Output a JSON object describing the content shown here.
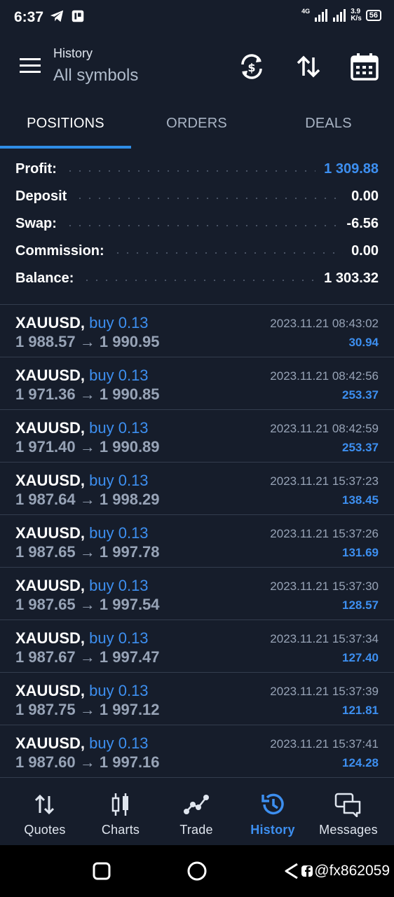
{
  "status_bar": {
    "time": "6:37",
    "network": "4G",
    "speed_top": "3.9",
    "speed_unit": "K/s",
    "battery": "56"
  },
  "header": {
    "title": "History",
    "subtitle": "All symbols"
  },
  "tabs": [
    {
      "label": "POSITIONS",
      "active": true
    },
    {
      "label": "ORDERS",
      "active": false
    },
    {
      "label": "DEALS",
      "active": false
    }
  ],
  "summary": [
    {
      "label": "Profit:",
      "value": "1 309.88",
      "accent": true
    },
    {
      "label": "Deposit",
      "value": "0.00",
      "accent": false
    },
    {
      "label": "Swap:",
      "value": "-6.56",
      "accent": false
    },
    {
      "label": "Commission:",
      "value": "0.00",
      "accent": false
    },
    {
      "label": "Balance:",
      "value": "1 303.32",
      "accent": false
    }
  ],
  "deals": [
    {
      "symbol": "XAUUSD,",
      "type": "buy 0.13",
      "open": "1 988.57",
      "close": "1 990.95",
      "time": "2023.11.21 08:43:02",
      "profit": "30.94"
    },
    {
      "symbol": "XAUUSD,",
      "type": "buy 0.13",
      "open": "1 971.36",
      "close": "1 990.85",
      "time": "2023.11.21 08:42:56",
      "profit": "253.37"
    },
    {
      "symbol": "XAUUSD,",
      "type": "buy 0.13",
      "open": "1 971.40",
      "close": "1 990.89",
      "time": "2023.11.21 08:42:59",
      "profit": "253.37"
    },
    {
      "symbol": "XAUUSD,",
      "type": "buy 0.13",
      "open": "1 987.64",
      "close": "1 998.29",
      "time": "2023.11.21 15:37:23",
      "profit": "138.45"
    },
    {
      "symbol": "XAUUSD,",
      "type": "buy 0.13",
      "open": "1 987.65",
      "close": "1 997.78",
      "time": "2023.11.21 15:37:26",
      "profit": "131.69"
    },
    {
      "symbol": "XAUUSD,",
      "type": "buy 0.13",
      "open": "1 987.65",
      "close": "1 997.54",
      "time": "2023.11.21 15:37:30",
      "profit": "128.57"
    },
    {
      "symbol": "XAUUSD,",
      "type": "buy 0.13",
      "open": "1 987.67",
      "close": "1 997.47",
      "time": "2023.11.21 15:37:34",
      "profit": "127.40"
    },
    {
      "symbol": "XAUUSD,",
      "type": "buy 0.13",
      "open": "1 987.75",
      "close": "1 997.12",
      "time": "2023.11.21 15:37:39",
      "profit": "121.81"
    },
    {
      "symbol": "XAUUSD,",
      "type": "buy 0.13",
      "open": "1 987.60",
      "close": "1 997.16",
      "time": "2023.11.21 15:37:41",
      "profit": "124.28"
    }
  ],
  "price_arrow": "→",
  "bottom_nav": [
    {
      "label": "Quotes",
      "icon": "quotes-icon",
      "active": false
    },
    {
      "label": "Charts",
      "icon": "charts-icon",
      "active": false
    },
    {
      "label": "Trade",
      "icon": "trade-icon",
      "active": false
    },
    {
      "label": "History",
      "icon": "history-icon",
      "active": true
    },
    {
      "label": "Messages",
      "icon": "messages-icon",
      "active": false
    }
  ],
  "watermark": "@fx862059",
  "colors": {
    "background": "#161d2b",
    "accent": "#3d8ff0",
    "muted": "#97a3b6"
  }
}
